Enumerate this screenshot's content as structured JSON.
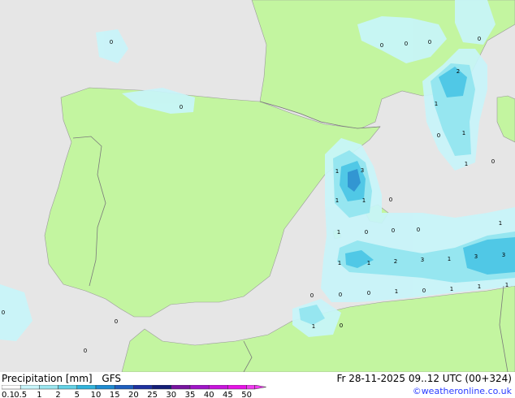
{
  "legend": {
    "title": "Precipitation [mm]",
    "model": "GFS",
    "ticks": [
      "0.1",
      "0.5",
      "1",
      "2",
      "5",
      "10",
      "15",
      "20",
      "25",
      "30",
      "35",
      "40",
      "45",
      "50"
    ],
    "colors": [
      "#ffffff",
      "#c8f5fa",
      "#9be6f0",
      "#64d2e6",
      "#32b4dc",
      "#1e8cd2",
      "#1e5fbe",
      "#1e32a0",
      "#141e78",
      "#7814a0",
      "#a014c8",
      "#c814dc",
      "#e614e6",
      "#f03cf0"
    ]
  },
  "run_info": "Fr 28-11-2025 09..12 UTC (00+324)",
  "credit": "©weatheronline.co.uk",
  "colors": {
    "land": "#c3f5a0",
    "sea": "#e6e6e6",
    "precip_light": "#c8f5fa",
    "precip_mid": "#96e6f0",
    "precip_heavy": "#50c8e6",
    "precip_core": "#3296d2",
    "border": "#7a7a7a"
  },
  "map_values": [
    "0",
    "0",
    "0",
    "0",
    "0",
    "2",
    "1",
    "0",
    "1",
    "1",
    "0",
    "1",
    "3",
    "1",
    "1",
    "0",
    "1",
    "0",
    "0",
    "0",
    "1",
    "1",
    "1",
    "2",
    "3",
    "1",
    "3",
    "3",
    "0",
    "0",
    "0",
    "1",
    "0",
    "1",
    "1",
    "1",
    "1",
    "0",
    "0",
    "0",
    "0",
    "0"
  ]
}
